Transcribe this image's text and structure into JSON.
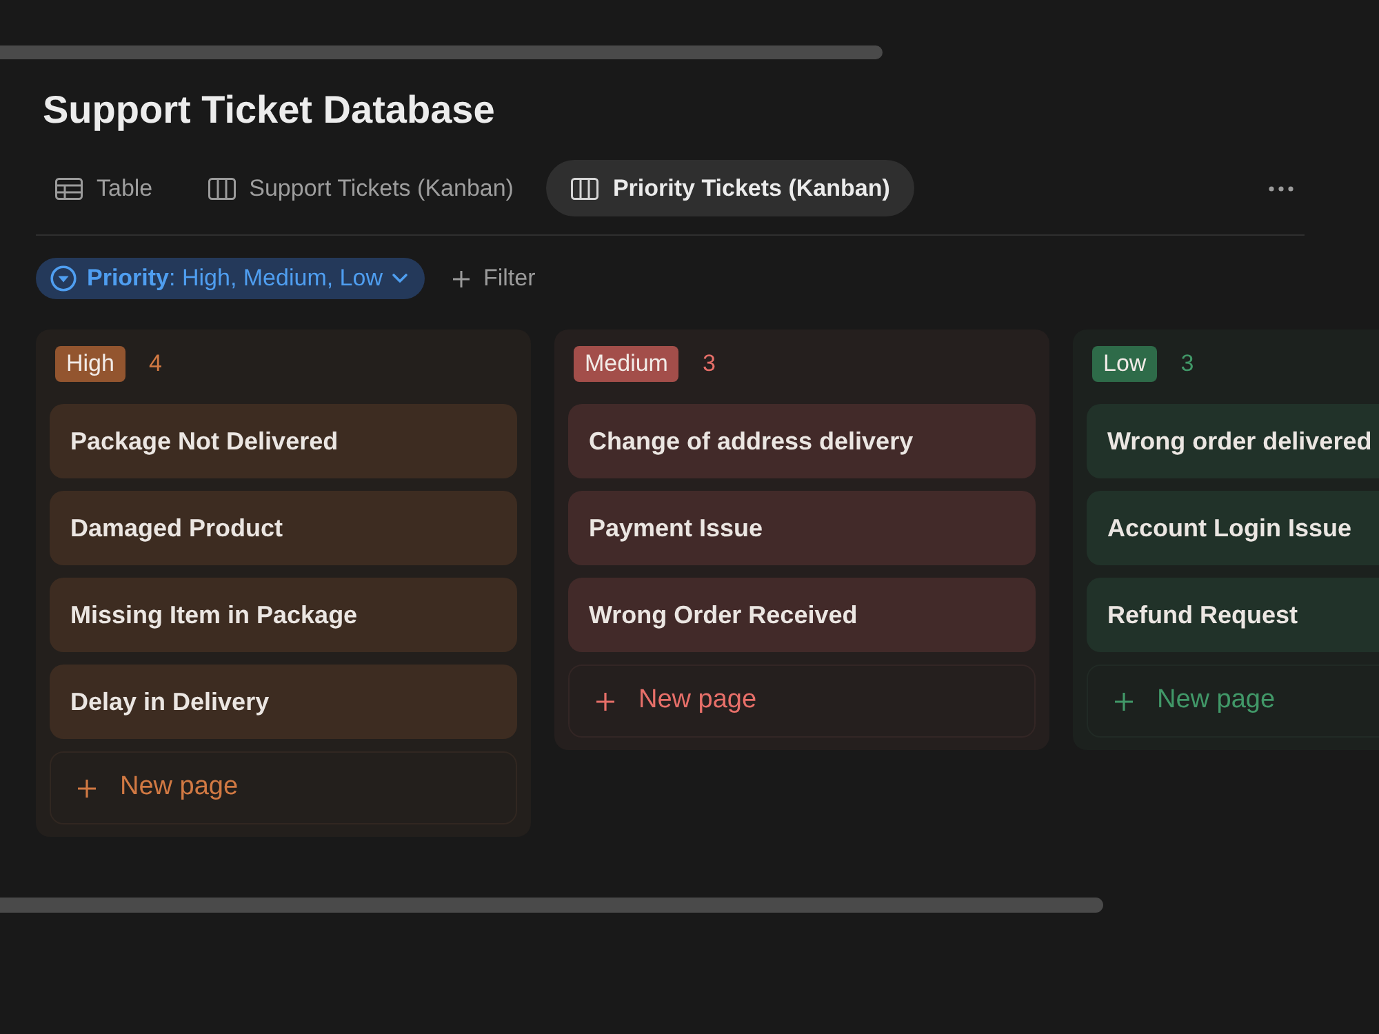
{
  "page": {
    "title": "Support Ticket Database"
  },
  "views": [
    {
      "kind": "table",
      "label": "Table",
      "selected": false
    },
    {
      "kind": "board",
      "label": "Support Tickets (Kanban)",
      "selected": false
    },
    {
      "kind": "board",
      "label": "Priority Tickets (Kanban)",
      "selected": true
    }
  ],
  "filters": {
    "active": {
      "label": "**Priority**: High, Medium, Low"
    },
    "add": {
      "label": "Filter"
    }
  },
  "columns": [
    {
      "label": "High",
      "count": "4",
      "color": "#93552f",
      "cards": [
        {
          "title": "Package Not Delivered"
        },
        {
          "title": "Damaged Product"
        },
        {
          "title": "Missing Item in Package"
        },
        {
          "title": "Delay in Delivery"
        }
      ],
      "new_page": "New page"
    },
    {
      "label": "Medium",
      "count": "3",
      "color": "#a34e4a",
      "cards": [
        {
          "title": "Change of address delivery"
        },
        {
          "title": "Payment Issue"
        },
        {
          "title": "Wrong Order Received"
        }
      ],
      "new_page": "New page"
    },
    {
      "label": "Low",
      "count": "3",
      "color": "#2e6b49",
      "cards": [
        {
          "title": "Wrong order delivered"
        },
        {
          "title": "Account Login Issue"
        },
        {
          "title": "Refund Request"
        }
      ],
      "new_page": "New page"
    }
  ]
}
